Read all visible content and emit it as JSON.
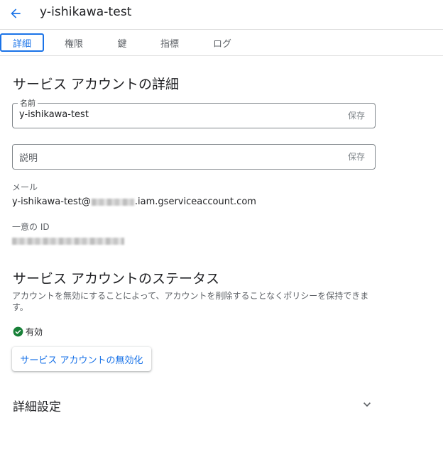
{
  "header": {
    "title": "y-ishikawa-test",
    "back_icon": "arrow-back-icon"
  },
  "tabs": [
    {
      "label": "詳細",
      "active": true
    },
    {
      "label": "権限",
      "active": false
    },
    {
      "label": "鍵",
      "active": false
    },
    {
      "label": "指標",
      "active": false
    },
    {
      "label": "ログ",
      "active": false
    }
  ],
  "details": {
    "title": "サービス アカウントの詳細",
    "name_field": {
      "label": "名前",
      "value": "y-ishikawa-test",
      "save_label": "保存"
    },
    "description_field": {
      "placeholder": "説明",
      "save_label": "保存"
    },
    "email": {
      "label": "メール",
      "prefix": "y-ishikawa-test@",
      "suffix": ".iam.gserviceaccount.com"
    },
    "unique_id": {
      "label": "一意の ID"
    }
  },
  "status": {
    "title": "サービス アカウントのステータス",
    "description": "アカウントを無効にすることによって、アカウントを削除することなくポリシーを保持できます。",
    "state_label": "有効",
    "state_color": "#188038",
    "disable_button": "サービス アカウントの無効化"
  },
  "advanced": {
    "title": "詳細設定"
  },
  "colors": {
    "accent": "#1a73e8",
    "text": "#202124",
    "secondary_text": "#5f6368"
  }
}
